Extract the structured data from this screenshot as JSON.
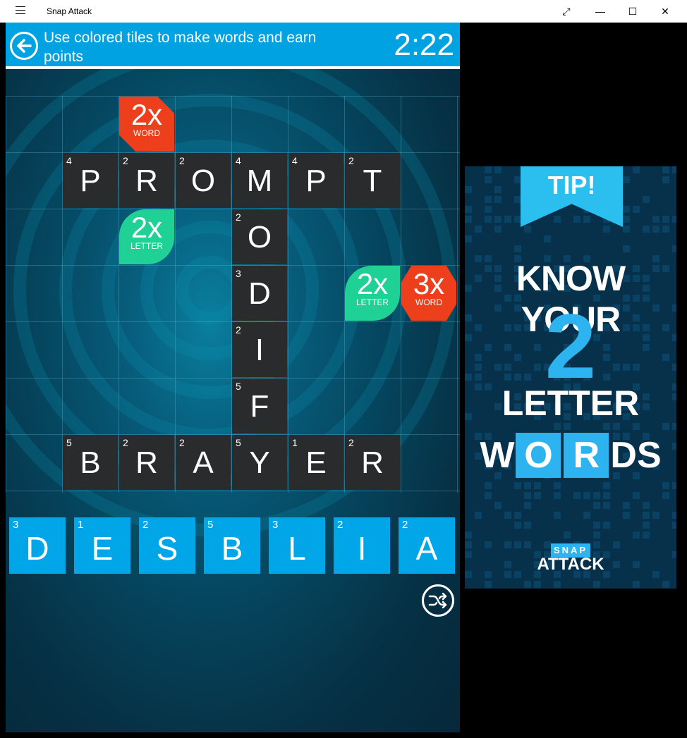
{
  "window": {
    "title": "Snap Attack",
    "controls": [
      "⤢",
      "—",
      "☐",
      "✕"
    ]
  },
  "header": {
    "instruction": "Use colored tiles to make words and earn points",
    "timer": "2:22"
  },
  "board": {
    "tiles": [
      {
        "letter": "P",
        "score": "4",
        "col": 1,
        "row": 1
      },
      {
        "letter": "R",
        "score": "2",
        "col": 2,
        "row": 1
      },
      {
        "letter": "O",
        "score": "2",
        "col": 3,
        "row": 1
      },
      {
        "letter": "M",
        "score": "4",
        "col": 4,
        "row": 1
      },
      {
        "letter": "P",
        "score": "4",
        "col": 5,
        "row": 1
      },
      {
        "letter": "T",
        "score": "2",
        "col": 6,
        "row": 1
      },
      {
        "letter": "O",
        "score": "2",
        "col": 4,
        "row": 2
      },
      {
        "letter": "D",
        "score": "3",
        "col": 4,
        "row": 3
      },
      {
        "letter": "I",
        "score": "2",
        "col": 4,
        "row": 4
      },
      {
        "letter": "F",
        "score": "5",
        "col": 4,
        "row": 5
      },
      {
        "letter": "B",
        "score": "5",
        "col": 1,
        "row": 6
      },
      {
        "letter": "R",
        "score": "2",
        "col": 2,
        "row": 6
      },
      {
        "letter": "A",
        "score": "2",
        "col": 3,
        "row": 6
      },
      {
        "letter": "Y",
        "score": "5",
        "col": 4,
        "row": 6
      },
      {
        "letter": "E",
        "score": "1",
        "col": 5,
        "row": 6
      },
      {
        "letter": "R",
        "score": "2",
        "col": 6,
        "row": 6
      }
    ],
    "bonuses": [
      {
        "mult": "2x",
        "kind": "WORD",
        "type": "word",
        "col": 2,
        "row": 0
      },
      {
        "mult": "2x",
        "kind": "LETTER",
        "type": "letter",
        "col": 2,
        "row": 2
      },
      {
        "mult": "2x",
        "kind": "LETTER",
        "type": "letter",
        "col": 6,
        "row": 3
      },
      {
        "mult": "3x",
        "kind": "WORD",
        "type": "word3",
        "col": 7,
        "row": 3
      }
    ]
  },
  "rack": [
    {
      "letter": "D",
      "score": "3"
    },
    {
      "letter": "E",
      "score": "1"
    },
    {
      "letter": "S",
      "score": "2"
    },
    {
      "letter": "B",
      "score": "5"
    },
    {
      "letter": "L",
      "score": "3"
    },
    {
      "letter": "I",
      "score": "2"
    },
    {
      "letter": "A",
      "score": "2"
    }
  ],
  "ad": {
    "tip": "TIP!",
    "line1": "KNOW YOUR",
    "big": "2",
    "line3": "LETTER",
    "word_prefix": "W",
    "word_hl1": "O",
    "word_hl2": "R",
    "word_suffix": "DS",
    "logo_top": "SNAP",
    "logo_bottom": "ATTACK"
  },
  "colors": {
    "accent": "#00a2e2",
    "tile_dark": "#2a2b2c",
    "bonus_word": "#ee3f1c",
    "bonus_letter": "#1fd195"
  }
}
